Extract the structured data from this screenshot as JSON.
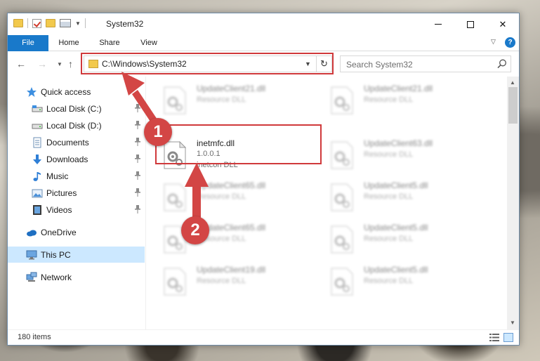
{
  "window": {
    "title": "System32",
    "controls": {
      "minimize": "minimize",
      "maximize": "maximize",
      "close": "✕"
    }
  },
  "ribbon": {
    "tabs": [
      "File",
      "Home",
      "Share",
      "View"
    ],
    "help": "?"
  },
  "nav": {
    "address": "C:\\Windows\\System32",
    "search_placeholder": "Search System32"
  },
  "sidebar": {
    "items": [
      {
        "label": "Quick access",
        "icon": "star-icon",
        "pinned": false
      },
      {
        "label": "Local Disk (C:)",
        "icon": "drive-icon",
        "pinned": true
      },
      {
        "label": "Local Disk (D:)",
        "icon": "drive-icon",
        "pinned": true
      },
      {
        "label": "Documents",
        "icon": "documents-icon",
        "pinned": true
      },
      {
        "label": "Downloads",
        "icon": "downloads-icon",
        "pinned": true
      },
      {
        "label": "Music",
        "icon": "music-icon",
        "pinned": true
      },
      {
        "label": "Pictures",
        "icon": "pictures-icon",
        "pinned": true
      },
      {
        "label": "Videos",
        "icon": "videos-icon",
        "pinned": true
      },
      {
        "label": "OneDrive",
        "icon": "cloud-icon",
        "pinned": false
      },
      {
        "label": "This PC",
        "icon": "monitor-icon",
        "pinned": false
      },
      {
        "label": "Network",
        "icon": "network-icon",
        "pinned": false
      }
    ]
  },
  "files": {
    "left": [
      {
        "name": "UpdateClient21.dll",
        "line2": "Resource DLL"
      },
      {
        "name": "inetmfc.dll",
        "line2": "1.0.0.1",
        "line3": "inetcon DLL"
      },
      {
        "name": "UpdateClient65.dll",
        "line2": "Resource DLL"
      },
      {
        "name": "UpdateClient65.dll",
        "line2": "Resource DLL"
      },
      {
        "name": "UpdateClient19.dll",
        "line2": "Resource DLL"
      }
    ],
    "right": [
      {
        "name": "UpdateClient21.dll",
        "line2": "Resource DLL"
      },
      {
        "name": "UpdateClient63.dll",
        "line2": "Resource DLL"
      },
      {
        "name": "UpdateClient5.dll",
        "line2": "Resource DLL"
      },
      {
        "name": "UpdateClient5.dll",
        "line2": "Resource DLL"
      },
      {
        "name": "UpdateClient5.dll",
        "line2": "Resource DLL"
      }
    ]
  },
  "status": {
    "count": "180 items"
  },
  "annotations": {
    "badge1": "1",
    "badge2": "2",
    "color": "#d0393b"
  }
}
